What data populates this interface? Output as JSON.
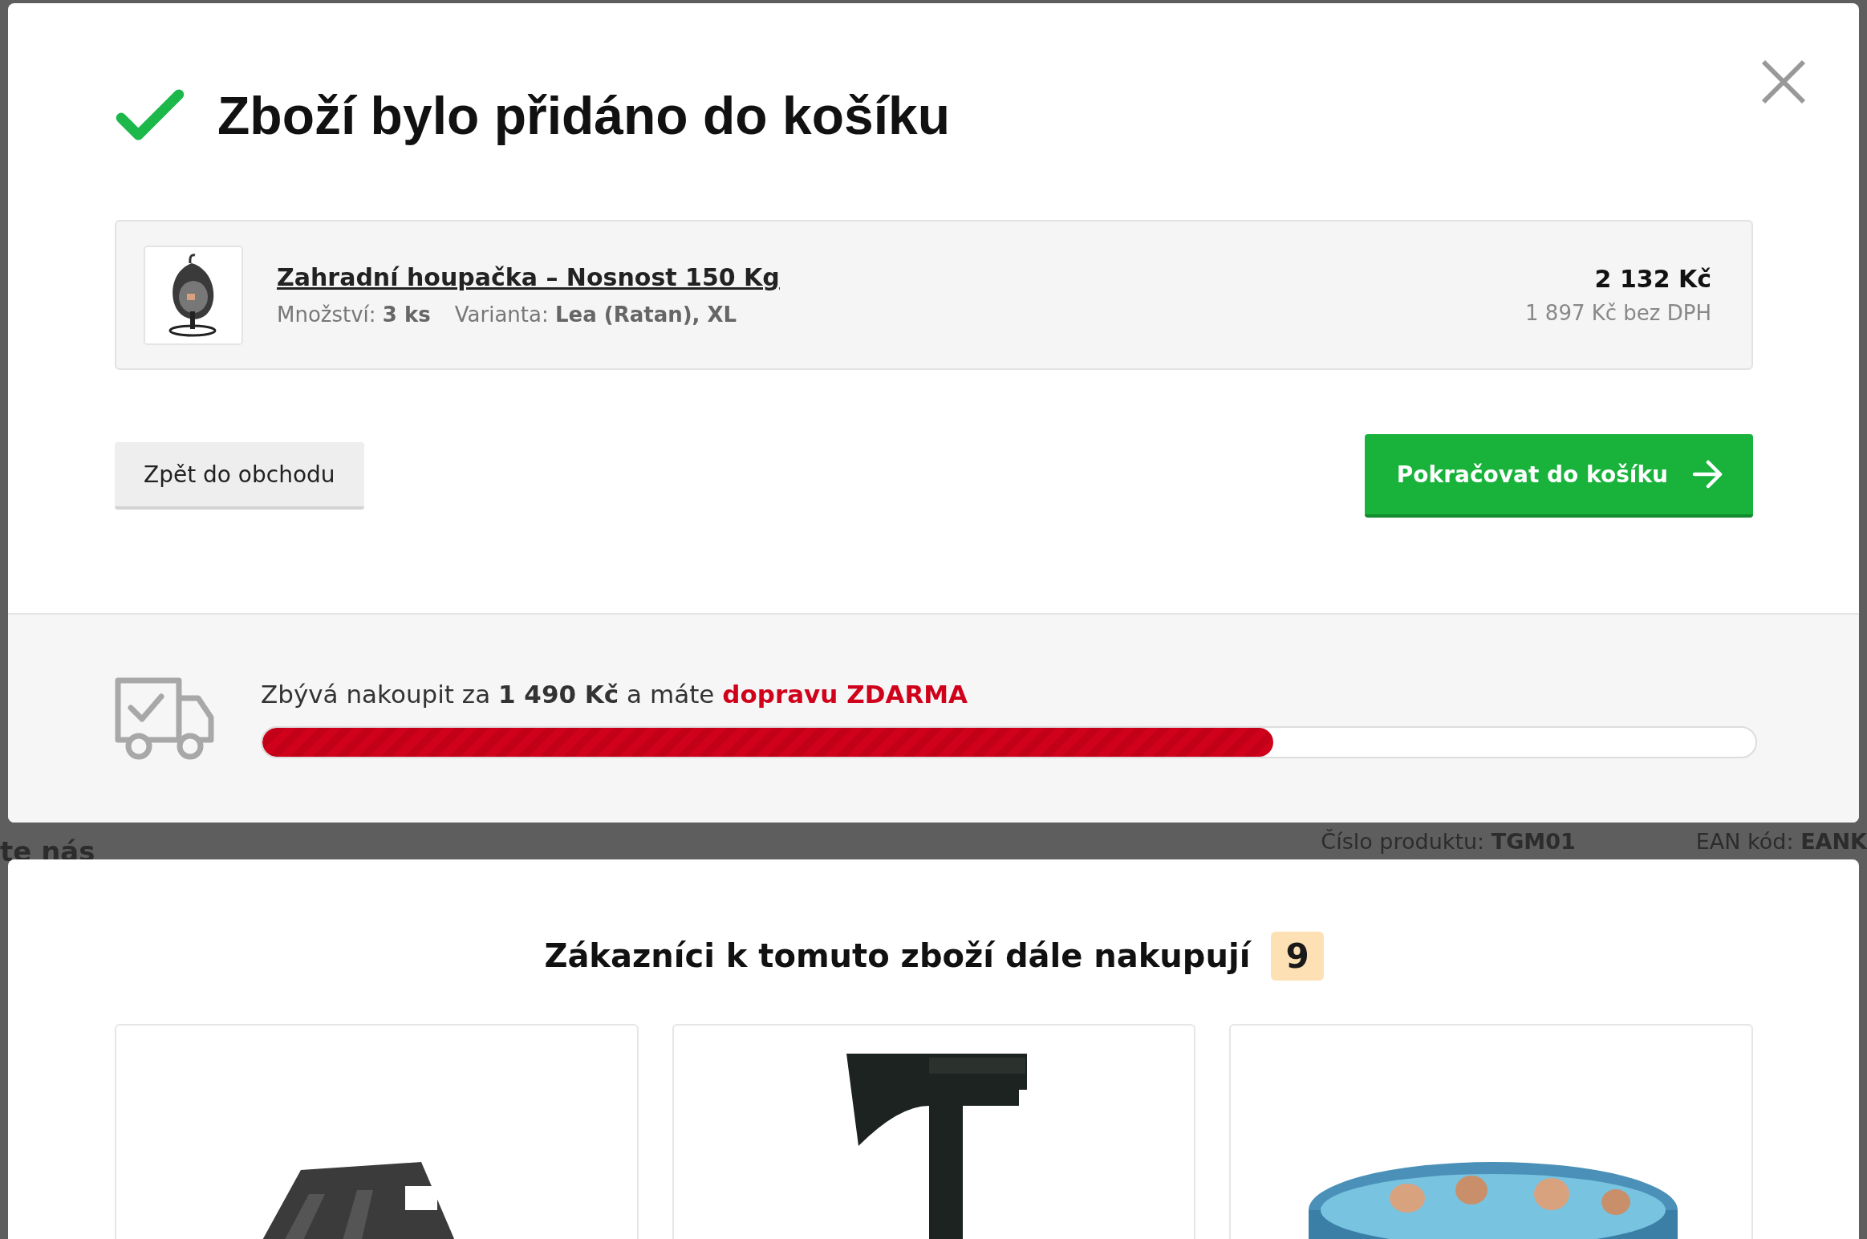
{
  "dialog": {
    "title": "Zboží bylo přidáno do košíku",
    "item": {
      "name": "Zahradní houpačka – Nosnost 150 Kg",
      "quantity_label": "Množství:",
      "quantity": "3 ks",
      "variant_label": "Varianta:",
      "variant": "Lea (Ratan), XL",
      "price": "2 132 Kč",
      "price_net": "1 897 Kč bez DPH"
    },
    "buttons": [
      {
        "label": "Zpět do obchodu",
        "kind": "secondary"
      },
      {
        "label": "Pokračovat do košíku",
        "kind": "primary"
      }
    ],
    "shipping": {
      "text": "Zbývá nakoupit za **1 490 Kč** a máte",
      "highlight": "dopravu ZDARMA",
      "level": 0.677
    }
  },
  "background_page": {
    "heading": "te nás",
    "product_number_label": "Číslo produktu:",
    "product_number": "TGM01",
    "ean_label": "EAN kód:",
    "ean": "EANK"
  },
  "recommendations": {
    "title": "Zákazníci k tomuto zboží dále nakupují",
    "count": "9"
  }
}
